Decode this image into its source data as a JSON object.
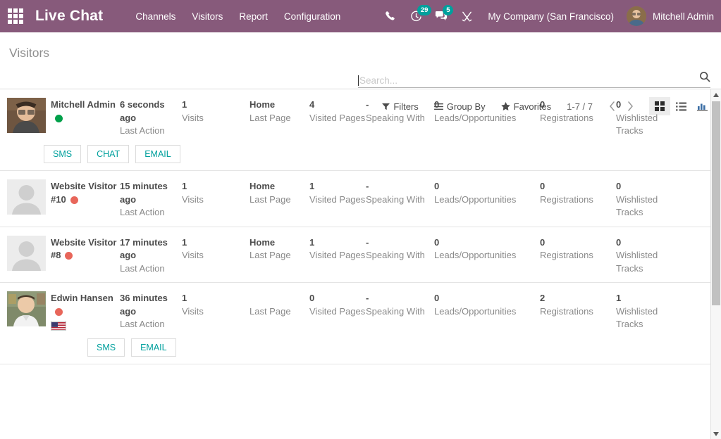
{
  "navbar": {
    "apps_icon": "apps-grid-icon",
    "brand": "Live Chat",
    "menu": [
      {
        "label": "Channels"
      },
      {
        "label": "Visitors"
      },
      {
        "label": "Report"
      },
      {
        "label": "Configuration"
      }
    ],
    "sys_icons": [
      {
        "name": "phone-icon",
        "badge": null
      },
      {
        "name": "activity-clock-icon",
        "badge": "29"
      },
      {
        "name": "messages-chat-icon",
        "badge": "5"
      },
      {
        "name": "developer-tools-icon",
        "badge": null
      }
    ],
    "company": "My Company (San Francisco)",
    "user_name": "Mitchell Admin",
    "background_color": "#875a7b",
    "badge_color": "#00a09d"
  },
  "control_panel": {
    "title": "Visitors",
    "search_placeholder": "Search...",
    "search_value": "",
    "filters_label": "Filters",
    "group_by_label": "Group By",
    "favorites_label": "Favorites",
    "pager": "1-7 / 7",
    "views": [
      {
        "name": "kanban-view-icon",
        "active": true
      },
      {
        "name": "list-view-icon",
        "active": false
      },
      {
        "name": "graph-view-icon",
        "active": false
      }
    ]
  },
  "columns": {
    "last_action": "Last Action",
    "visits": "Visits",
    "last_page": "Last Page",
    "visited_pages": "Visited Pages",
    "speaking_with": "Speaking With",
    "leads": "Leads/Opportunities",
    "registrations": "Registrations",
    "wishlisted": "Wishlisted Tracks"
  },
  "status_colors": {
    "online": "#00a04a",
    "offline": "#e8665a"
  },
  "accent_color": "#00a09d",
  "records": [
    {
      "name": "Mitchell Admin",
      "status": "online",
      "avatar": "photo",
      "flag": null,
      "last_action": "6 seconds ago",
      "visits": "1",
      "last_page": "Home",
      "visited_pages": "4",
      "speaking_with": "-",
      "leads": "0",
      "registrations": "0",
      "wishlisted": "0",
      "actions": [
        "SMS",
        "CHAT",
        "EMAIL"
      ]
    },
    {
      "name": "Website Visitor #10",
      "status": "offline",
      "avatar": "placeholder",
      "flag": null,
      "last_action": "15 minutes ago",
      "visits": "1",
      "last_page": "Home",
      "visited_pages": "1",
      "speaking_with": "-",
      "leads": "0",
      "registrations": "0",
      "wishlisted": "0",
      "actions": []
    },
    {
      "name": "Website Visitor #8",
      "status": "offline",
      "avatar": "placeholder",
      "flag": null,
      "last_action": "17 minutes ago",
      "visits": "1",
      "last_page": "Home",
      "visited_pages": "1",
      "speaking_with": "-",
      "leads": "0",
      "registrations": "0",
      "wishlisted": "0",
      "actions": []
    },
    {
      "name": "Edwin Hansen",
      "status": "offline",
      "avatar": "photo",
      "flag": "us-flag-icon",
      "last_action": "36 minutes ago",
      "visits": "1",
      "last_page": "",
      "visited_pages": "0",
      "speaking_with": "-",
      "leads": "0",
      "registrations": "2",
      "wishlisted": "1",
      "actions": [
        "SMS",
        "EMAIL"
      ]
    }
  ]
}
